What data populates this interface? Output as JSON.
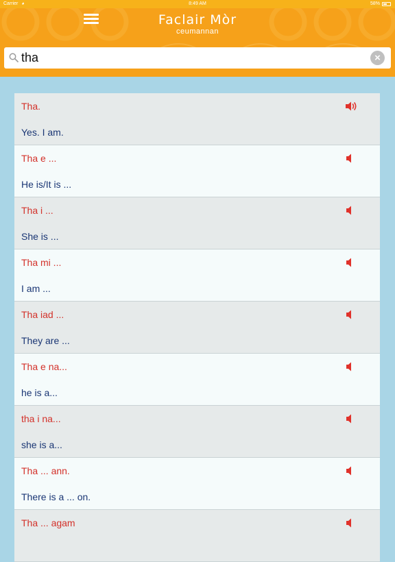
{
  "status_bar": {
    "carrier": "Carrier",
    "time": "8:49 AM",
    "battery": "58%",
    "battery_level": 0.58
  },
  "header": {
    "title": "Faclair Mòr",
    "subtitle": "ceumannan",
    "background_color": "#f6a11a"
  },
  "search": {
    "value": "tha",
    "clear_icon": "×"
  },
  "results": [
    {
      "gaelic": "Tha.",
      "english": "Yes. I am.",
      "audio_playing": true
    },
    {
      "gaelic": "Tha e ...",
      "english": "He is/It is ...",
      "audio_playing": false
    },
    {
      "gaelic": "Tha i ...",
      "english": "She is ...",
      "audio_playing": false
    },
    {
      "gaelic": "Tha mi ...",
      "english": "I am ...",
      "audio_playing": false
    },
    {
      "gaelic": "Tha iad ...",
      "english": "They are ...",
      "audio_playing": false
    },
    {
      "gaelic": "Tha e na...",
      "english": "he is a...",
      "audio_playing": false
    },
    {
      "gaelic": "tha i na...",
      "english": "she is a...",
      "audio_playing": false
    },
    {
      "gaelic": "Tha ... ann.",
      "english": "There is a ... on.",
      "audio_playing": false
    },
    {
      "gaelic": "Tha ... agam",
      "english": "",
      "audio_playing": false
    }
  ],
  "colors": {
    "gaelic_text": "#d3312a",
    "english_text": "#1a3674",
    "background": "#a9d5e6",
    "speaker": "#e0322b"
  },
  "icons": {
    "menu": "hamburger-menu-icon",
    "search": "magnifier-icon",
    "clear": "clear-circle-icon",
    "speaker": "speaker-icon"
  }
}
